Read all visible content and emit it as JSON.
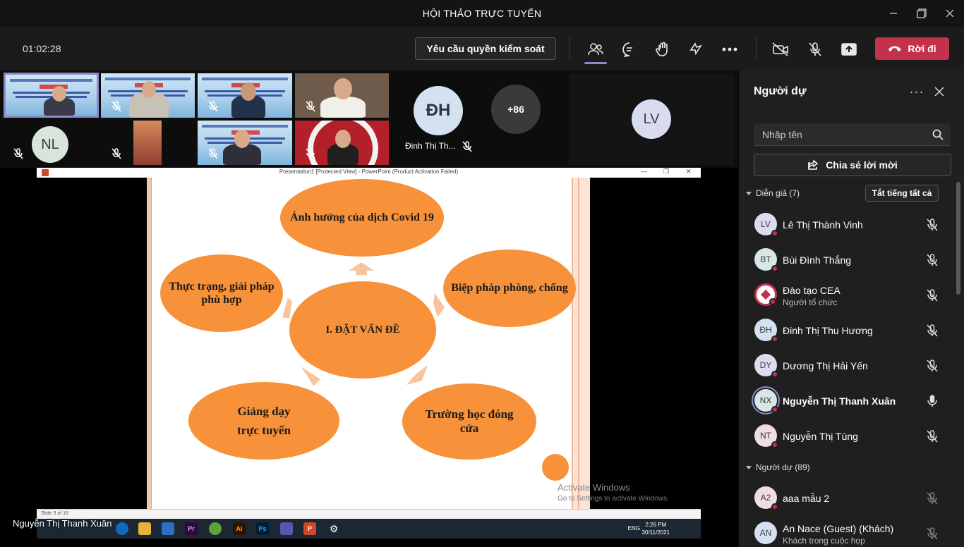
{
  "window": {
    "title": "HỘI THẢO TRỰC TUYẾN"
  },
  "meeting": {
    "timer": "01:02:28",
    "request_control_label": "Yêu cầu quyền kiểm soát",
    "leave_label": "Rời đi",
    "leave_color": "#c4314b"
  },
  "video_strip": {
    "tiles": [
      {
        "type": "video"
      },
      {
        "type": "video"
      },
      {
        "type": "video"
      },
      {
        "type": "video"
      },
      {
        "type": "avatar",
        "initials": "NL"
      },
      {
        "type": "video"
      },
      {
        "type": "video"
      },
      {
        "type": "video"
      }
    ],
    "dh_initials": "ĐH",
    "dh_name": "Đinh Thị Th...",
    "overflow_count": "+86",
    "lv_initials": "LV"
  },
  "shared_screen": {
    "ppt_window_title": "Presentation1 [Protected View] - PowerPoint (Product Activation Failed)",
    "slide_status": "Slide 3 of 16",
    "slide": {
      "center": "I. ĐẶT VẤN ĐỀ",
      "top": "Ảnh hưởng của dịch Covid 19",
      "left": "Thực trạng, giải pháp phù hợp",
      "right": "Biệp pháp phòng, chống",
      "bottom_left_1": "Giảng dạy",
      "bottom_left_2": "trực tuyến",
      "bottom_right": "Trường học đóng cửa",
      "accent": "#f7923a"
    },
    "activate_title": "Activate Windows",
    "activate_sub": "Go to Settings to activate Windows.",
    "taskbar": {
      "lang": "ENG",
      "time": "2:26 PM",
      "date": "30/11/2021"
    },
    "presenter_name": "Nguyễn Thị Thanh Xuân"
  },
  "panel": {
    "title": "Người dự",
    "search_placeholder": "Nhập tên",
    "share_invite_label": "Chia sẻ lời mời",
    "presenters_header": "Diễn giả (7)",
    "mute_all_label": "Tắt tiếng tất cả",
    "attendees_header": "Người dự (89)",
    "presenters": [
      {
        "initials": "LV",
        "name": "Lê Thị Thành Vinh",
        "mic": "muted"
      },
      {
        "initials": "BT",
        "name": "Bùi Đình Thắng",
        "mic": "muted"
      },
      {
        "initials": "",
        "name": "Đào tạo CEA",
        "role": "Người tổ chức",
        "mic": "muted"
      },
      {
        "initials": "ĐH",
        "name": "Đinh Thị Thu Hương",
        "mic": "muted"
      },
      {
        "initials": "DY",
        "name": "Dương Thị Hải Yến",
        "mic": "muted"
      },
      {
        "initials": "NX",
        "name": "Nguyễn Thị Thanh Xuân",
        "mic": "on"
      },
      {
        "initials": "NT",
        "name": "Nguyễn Thị Tùng",
        "mic": "muted"
      }
    ],
    "attendees": [
      {
        "initials": "A2",
        "name": "aaa mẫu 2"
      },
      {
        "initials": "AN",
        "name": "An Nace (Guest) (Khách)",
        "role": "Khách trong cuộc họp"
      }
    ]
  }
}
